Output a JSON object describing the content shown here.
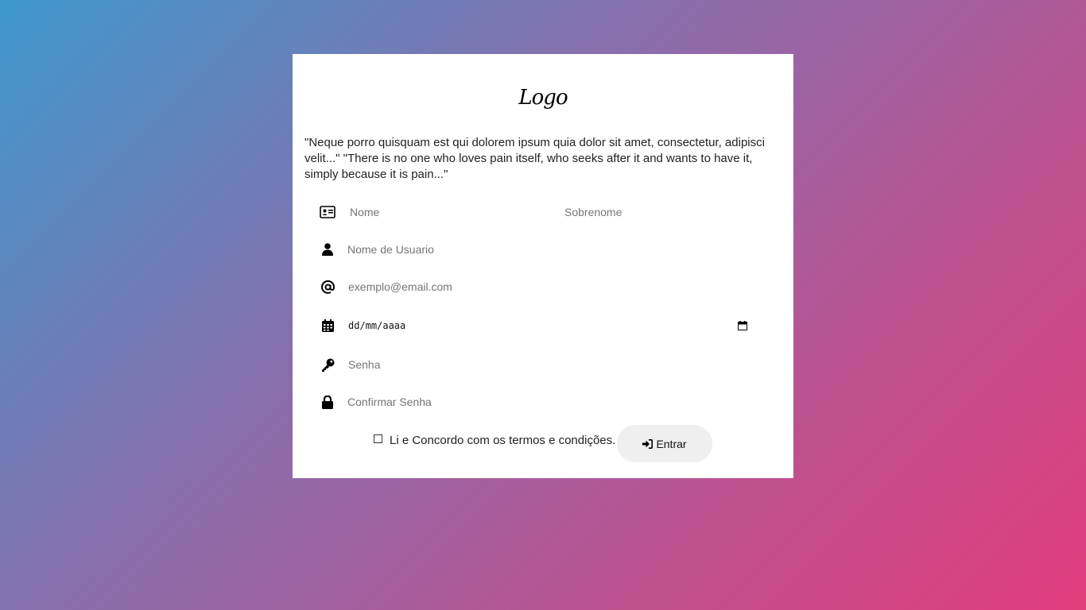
{
  "logo": "Logo",
  "quote": "\"Neque porro quisquam est qui dolorem ipsum quia dolor sit amet, consectetur, adipisci velit...\" \"There is no one who loves pain itself, who seeks after it and wants to have it, simply because it is pain...\"",
  "form": {
    "first_name_placeholder": "Nome",
    "last_name_placeholder": "Sobrenome",
    "username_placeholder": "Nome de Usuario",
    "email_placeholder": "exemplo@email.com",
    "date_placeholder": "dd/mm/aaaa",
    "password_placeholder": "Senha",
    "confirm_password_placeholder": "Confirmar Senha",
    "terms_label": "Li e Concordo com os termos e condições.",
    "submit_label": "Entrar"
  },
  "icons": {
    "name": "id-card-icon",
    "username": "user-icon",
    "email": "at-icon",
    "date": "calendar-icon",
    "password": "key-icon",
    "confirm_password": "lock-icon",
    "submit": "sign-in-icon",
    "date_picker": "calendar-picker-icon"
  },
  "colors": {
    "gradient_start": "#3e98cc",
    "gradient_end": "#e23d7c",
    "card_bg": "#ffffff",
    "button_bg": "#efefef"
  }
}
